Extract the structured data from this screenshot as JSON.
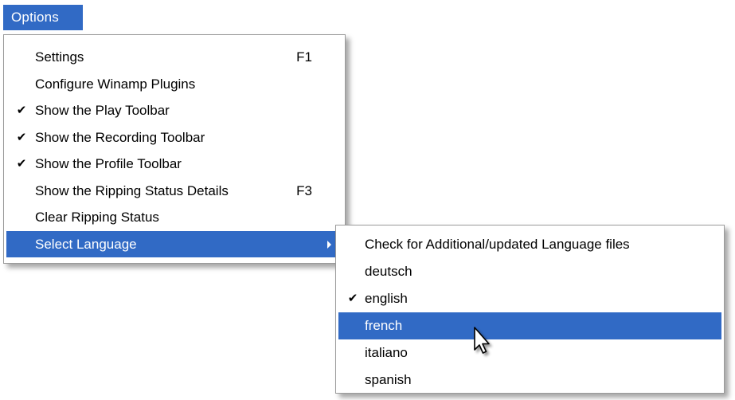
{
  "menubar": {
    "options_label": "Options"
  },
  "options_menu": {
    "items": [
      {
        "label": "Settings",
        "shortcut": "F1",
        "checked": false
      },
      {
        "label": "Configure Winamp Plugins",
        "shortcut": "",
        "checked": false
      },
      {
        "label": "Show the Play Toolbar",
        "shortcut": "",
        "checked": true
      },
      {
        "label": "Show the Recording Toolbar",
        "shortcut": "",
        "checked": true
      },
      {
        "label": "Show the Profile Toolbar",
        "shortcut": "",
        "checked": true
      },
      {
        "label": "Show the Ripping Status Details",
        "shortcut": "F3",
        "checked": false
      },
      {
        "label": "Clear Ripping Status",
        "shortcut": "",
        "checked": false
      },
      {
        "label": "Select Language",
        "shortcut": "",
        "checked": false,
        "has_submenu": true,
        "selected": true
      }
    ]
  },
  "language_menu": {
    "items": [
      {
        "label": "Check for Additional/updated Language files",
        "checked": false
      },
      {
        "label": "deutsch",
        "checked": false
      },
      {
        "label": "english",
        "checked": true
      },
      {
        "label": "french",
        "checked": false,
        "selected": true
      },
      {
        "label": "italiano",
        "checked": false
      },
      {
        "label": "spanish",
        "checked": false
      }
    ]
  },
  "check_glyph": "✔",
  "colors": {
    "highlight": "#316ac5",
    "highlight_text": "#ffffff",
    "menu_bg": "#ffffff",
    "menu_border": "#9a9a9a"
  },
  "icons": {
    "check": "checkmark-icon",
    "submenu": "chevron-right-icon",
    "cursor": "mouse-pointer-icon"
  }
}
